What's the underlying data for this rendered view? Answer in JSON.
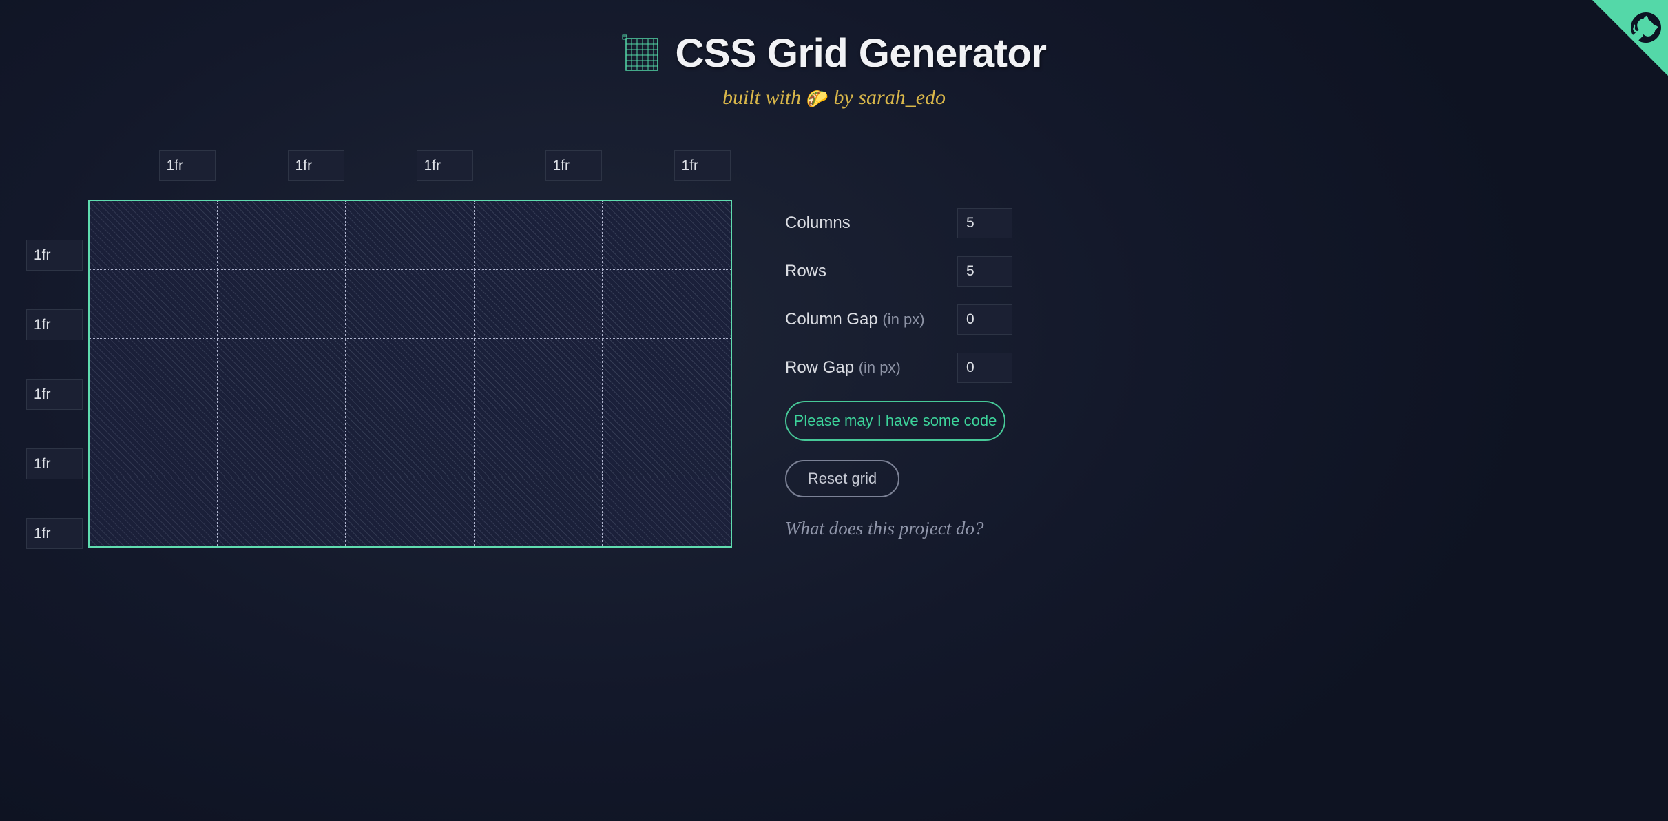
{
  "header": {
    "title": "CSS Grid Generator",
    "subtitle_prefix": "built with ",
    "subtitle_suffix": " by ",
    "author": "sarah_edo"
  },
  "column_units": [
    "1fr",
    "1fr",
    "1fr",
    "1fr",
    "1fr"
  ],
  "row_units": [
    "1fr",
    "1fr",
    "1fr",
    "1fr",
    "1fr"
  ],
  "controls": {
    "columns": {
      "label": "Columns",
      "value": "5"
    },
    "rows": {
      "label": "Rows",
      "value": "5"
    },
    "column_gap": {
      "label": "Column Gap ",
      "hint": "(in px)",
      "value": "0"
    },
    "row_gap": {
      "label": "Row Gap ",
      "hint": "(in px)",
      "value": "0"
    }
  },
  "buttons": {
    "generate": "Please may I have some code",
    "reset": "Reset grid"
  },
  "info_link": "What does this project do?"
}
